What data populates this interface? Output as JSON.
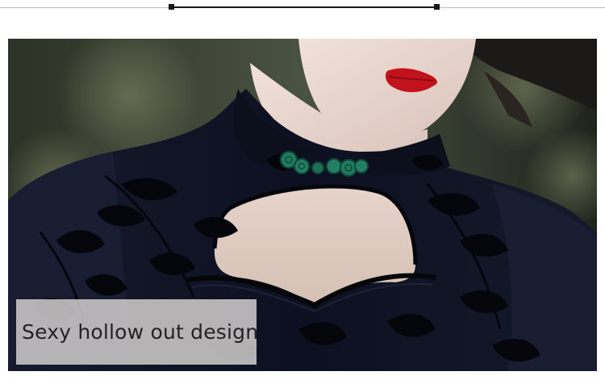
{
  "caption": {
    "text": "Sexy hollow out design"
  },
  "photo": {
    "subject": "dress-product-photo",
    "colors": {
      "background": "#3a4136",
      "dress": "#0e1120",
      "pattern": "#05060c",
      "skin": "#e9d7cf",
      "lips": "#c2121b",
      "button_knot": "#1f7a5e"
    }
  }
}
